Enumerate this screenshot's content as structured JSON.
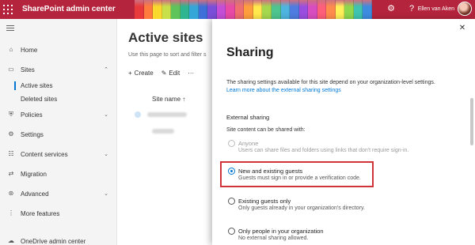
{
  "header": {
    "title": "SharePoint admin center",
    "user_name": "Ellen van Aken",
    "crayon_colors": [
      "#e83a3a",
      "#ff7a3d",
      "#f9d92e",
      "#c8e04a",
      "#5fc45a",
      "#2fb58f",
      "#35a6d8",
      "#3d6fd8",
      "#7a4ed8",
      "#c44ed8",
      "#e84aa5",
      "#f06f6f",
      "#ff9e3d",
      "#ffe94d",
      "#a6d84e",
      "#4ec48f",
      "#4eb5e0",
      "#4e7ce0",
      "#9a4ee0",
      "#d84ec0",
      "#ff5f7a",
      "#ff8c4e",
      "#fff05a",
      "#8ed84e",
      "#3ec4b0",
      "#3e8ce0"
    ]
  },
  "icons": {
    "waffle": "waffle-icon",
    "settings": "gear-icon",
    "help": "help-icon",
    "close": "close-icon"
  },
  "nav": {
    "items": [
      {
        "label": "Home",
        "icon": "home-icon",
        "glyph": "⌂"
      },
      {
        "label": "Sites",
        "icon": "sites-icon",
        "glyph": "▭",
        "chevron": "⌃"
      },
      {
        "label": "Policies",
        "icon": "policies-icon",
        "glyph": "⛨",
        "chevron": "⌄"
      },
      {
        "label": "Settings",
        "icon": "gear-icon",
        "glyph": "⚙"
      },
      {
        "label": "Content services",
        "icon": "content-services-icon",
        "glyph": "☷",
        "chevron": "⌄"
      },
      {
        "label": "Migration",
        "icon": "migration-icon",
        "glyph": "⇄"
      },
      {
        "label": "Advanced",
        "icon": "advanced-icon",
        "glyph": "⊛",
        "chevron": "⌄"
      },
      {
        "label": "More features",
        "icon": "more-features-icon",
        "glyph": "⋮"
      },
      {
        "label": "OneDrive admin center",
        "icon": "onedrive-icon",
        "glyph": "☁"
      }
    ],
    "sub_items": [
      "Active sites",
      "Deleted sites"
    ]
  },
  "main": {
    "title": "Active sites",
    "description": "Use this page to sort and filter s",
    "commands": [
      {
        "label": "Create",
        "glyph": "+"
      },
      {
        "label": "Edit",
        "glyph": "✎"
      },
      {
        "label": "",
        "glyph": "···"
      }
    ],
    "column_header": "Site name ↑"
  },
  "panel": {
    "title": "Sharing",
    "description": "The sharing settings available for this site depend on your organization-level settings.",
    "link": "Learn more about the external sharing settings",
    "section_title": "External sharing",
    "content_label": "Site content can be shared with:",
    "options": [
      {
        "label": "Anyone",
        "description": "Users can share files and folders using links that don't require sign-in.",
        "state": "disabled"
      },
      {
        "label": "New and existing guests",
        "description": "Guests must sign in or provide a verification code.",
        "state": "selected"
      },
      {
        "label": "Existing guests only",
        "description": "Only guests already in your organization's directory.",
        "state": "normal"
      },
      {
        "label": "Only people in your organization",
        "description": "No external sharing allowed.",
        "state": "normal"
      }
    ]
  },
  "colors": {
    "header_bg": "#b4243c",
    "accent": "#0078d4",
    "highlight_border": "#d13438"
  }
}
